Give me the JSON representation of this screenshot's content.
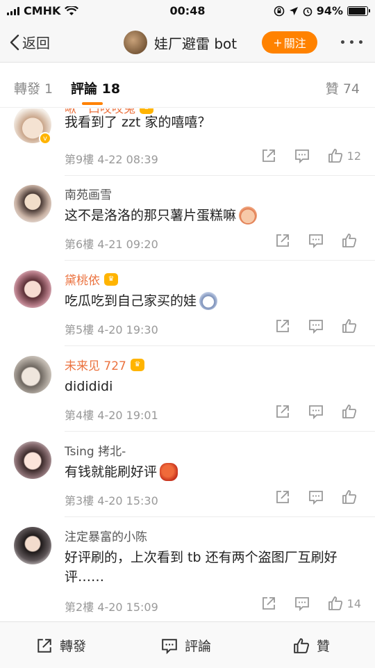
{
  "status_bar": {
    "carrier": "CMHK",
    "time": "00:48",
    "battery": "94%",
    "battery_level": 0.94
  },
  "nav": {
    "back_label": "返回",
    "title": "娃厂避雷 bot",
    "follow_label": "關注",
    "follow_plus": "+"
  },
  "tabs": {
    "repost": "轉發 1",
    "comments": "評論 18",
    "likes": "贊 74"
  },
  "comments": [
    {
      "name": "啾一口哎哎兔",
      "text": "我看到了 zzt 家的嘻嘻？",
      "floor": "第9樓",
      "date": "4-22 08:39",
      "likes": "12"
    },
    {
      "name": "南苑画雪",
      "text": "这不是洛洛的那只薯片蛋糕嘛",
      "floor": "第6樓",
      "date": "4-21 09:20",
      "likes": ""
    },
    {
      "name": "黛桃依",
      "text": "吃瓜吃到自己家买的娃",
      "floor": "第5樓",
      "date": "4-20 19:30",
      "likes": ""
    },
    {
      "name": "未来见 727",
      "text": "didididi",
      "floor": "第4樓",
      "date": "4-20 19:01",
      "likes": ""
    },
    {
      "name": "Tsing 拷北-",
      "text": "有钱就能刷好评",
      "floor": "第3樓",
      "date": "4-20 15:30",
      "likes": ""
    },
    {
      "name": "注定暴富的小陈",
      "text": "好评刷的，上次看到 tb 还有两个盗图厂互刷好评……",
      "floor": "第2樓",
      "date": "4-20 15:09",
      "likes": "14"
    }
  ],
  "bottom_bar": {
    "repost": "轉發",
    "comment": "評論",
    "like": "贊"
  },
  "colors": {
    "accent": "#ff8200",
    "vip_name": "#eb7340"
  }
}
